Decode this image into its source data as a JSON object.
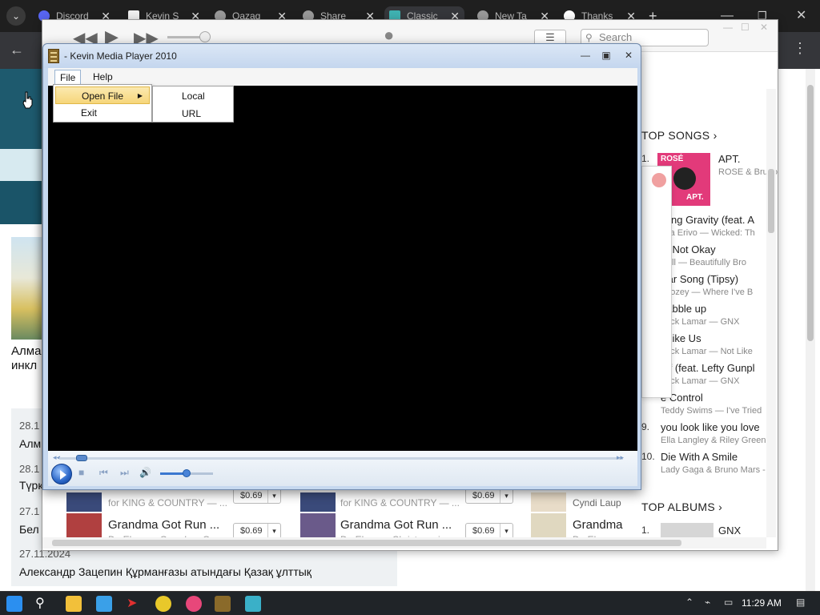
{
  "browser": {
    "tabs": [
      {
        "label": "Discord",
        "color": "#5865f2"
      },
      {
        "label": "Kevin S",
        "color": "#f0f0f0"
      },
      {
        "label": "Qazaq",
        "color": "#aaaaaa"
      },
      {
        "label": "Share",
        "color": "#aaaaaa"
      },
      {
        "label": "Classic",
        "color": "#3fb1b1"
      },
      {
        "label": "New Ta",
        "color": "#aaaaaa"
      },
      {
        "label": "Thanks",
        "color": "#ffffff"
      }
    ],
    "new_tab": "+",
    "window_controls": {
      "minimize": "—",
      "restore": "❐",
      "close": "✕"
    },
    "back": "←",
    "more": "⋮"
  },
  "itunes": {
    "search_placeholder": "Search",
    "top_songs_header": "TOP SONGS ›",
    "top_albums_header": "TOP ALBUMS ›",
    "album_art": {
      "line1": "ROSÉ",
      "line2": "APT."
    },
    "songs": [
      {
        "num": "1.",
        "title": "APT.",
        "artist": "ROSE & Bruno"
      },
      {
        "num": "",
        "title": "fying Gravity (feat. A",
        "artist": "thia Erivo — Wicked: Th"
      },
      {
        "num": "",
        "title": "m Not Okay",
        "artist": "Roll — Beautifully Bro"
      },
      {
        "num": "",
        "title": "Bar Song (Tipsy)",
        "artist": "boozey — Where I've B"
      },
      {
        "num": "",
        "title": "uabble up",
        "artist": "drick Lamar — GNX"
      },
      {
        "num": "",
        "title": "t Like Us",
        "artist": "drick Lamar — Not Like"
      },
      {
        "num": "",
        "title": "off (feat. Lefty Gunpl",
        "artist": "drick Lamar — GNX"
      },
      {
        "num": "",
        "title": "e Control",
        "artist": "Teddy Swims — I've Tried"
      },
      {
        "num": "9.",
        "title": "you look like you love",
        "artist": "Ella Langley & Riley Green"
      },
      {
        "num": "10.",
        "title": "Die With A Smile",
        "artist": "Lady Gaga & Bruno Mars -"
      }
    ],
    "album": {
      "num": "1.",
      "title": "GNX"
    },
    "rows": [
      {
        "sub_top": "for KING & COUNTRY — ...",
        "price_top": "$0.69",
        "title": "Grandma Got Run ...",
        "sub": "Dr. Elmo — Grandma Go",
        "price": "$0.69"
      },
      {
        "sub_top": "for KING & COUNTRY — ...",
        "price_top": "$0.69",
        "title": "Grandma Got Run ...",
        "sub": "Dr. Elmo — Christmas in",
        "price": "$0.69"
      },
      {
        "sub_top": "Cyndi Laup",
        "title": "Grandma",
        "sub": "Dr. Elmo"
      }
    ]
  },
  "webpage": {
    "headline1": "Алма",
    "headline2": "инкл",
    "news": [
      {
        "date": "28.1",
        "title": "Алм"
      },
      {
        "date": "28.1",
        "title": "Түрк"
      },
      {
        "date": "27.1",
        "title": "Бел"
      },
      {
        "date": "27.11.2024",
        "title": "Александр Зацепин Құрманғазы атындағы Қазақ ұлттық"
      }
    ]
  },
  "player": {
    "title": "- Kevin Media Player 2010",
    "menu": {
      "file": "File",
      "help": "Help"
    },
    "file_menu": {
      "open_file": "Open File",
      "exit": "Exit"
    },
    "open_submenu": {
      "local": "Local",
      "url": "URL"
    },
    "controls": {
      "play": "Play",
      "stop": "■",
      "prev": "⏮",
      "next": "⏭",
      "volume": "🔊"
    },
    "seek_position": 0.03,
    "volume_level": 0.5
  },
  "taskbar": {
    "time": "11:29 AM",
    "apps": [
      "start",
      "search",
      "file-explorer",
      "store",
      "media",
      "chrome",
      "itunes",
      "kevin-media-player",
      "other-app"
    ]
  }
}
